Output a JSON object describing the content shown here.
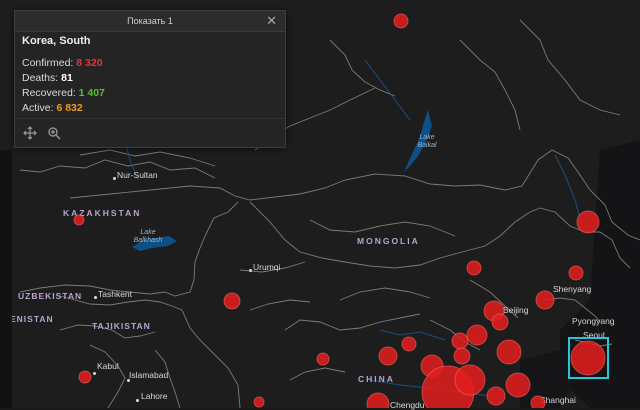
{
  "popup": {
    "header": "Показать 1",
    "location": "Korea, South",
    "confirmed_label": "Confirmed:",
    "confirmed_value": "8 320",
    "deaths_label": "Deaths:",
    "deaths_value": "81",
    "recovered_label": "Recovered:",
    "recovered_value": "1 407",
    "active_label": "Active:",
    "active_value": "6 832",
    "footer_icons": [
      "pan-icon",
      "zoom-to-icon"
    ]
  },
  "map": {
    "countries": [
      "KAZAKHSTAN",
      "MONGOLIA",
      "CHINA",
      "UZBEKISTAN",
      "TAJIKISTAN",
      "ENISTAN"
    ],
    "cities": [
      "Nur-Sultan",
      "Urumqi",
      "Tashkent",
      "Kabul",
      "Islamabad",
      "Lahore",
      "Shenyang",
      "Pyongyang",
      "Seoul",
      "Beijing",
      "Chengdu",
      "Shanghai"
    ],
    "lakes": [
      "Lake Baikal",
      "Lake Balkhash"
    ],
    "colors": {
      "marker": "#e01e1e",
      "highlight": "#27c6d9",
      "background": "#1d1d1d",
      "border": "#7a7a7a"
    },
    "selected_feature": "Korea, South"
  }
}
